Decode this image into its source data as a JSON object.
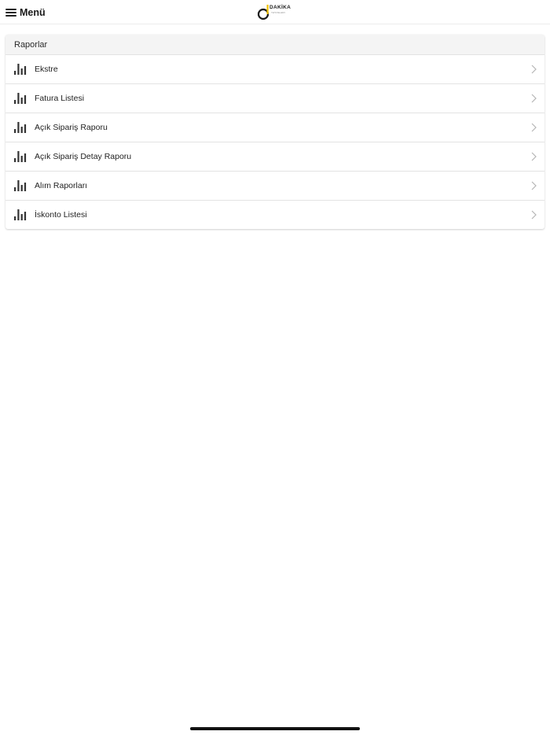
{
  "header": {
    "menu_label": "Menü",
    "logo_text": "DAKİKA",
    "logo_subtext": "YAYINLARI"
  },
  "card": {
    "title": "Raporlar",
    "items": [
      {
        "label": "Ekstre",
        "icon": "bar-chart-icon"
      },
      {
        "label": "Fatura Listesi",
        "icon": "bar-chart-icon"
      },
      {
        "label": "Açık Sipariş Raporu",
        "icon": "bar-chart-icon"
      },
      {
        "label": "Açık Sipariş Detay Raporu",
        "icon": "bar-chart-icon"
      },
      {
        "label": "Alım Raporları",
        "icon": "bar-chart-icon"
      },
      {
        "label": "İskonto Listesi",
        "icon": "bar-chart-icon"
      }
    ]
  },
  "colors": {
    "logo_accent": "#f2c200",
    "text_primary": "#1f1f1f",
    "header_bg": "#f4f4f4",
    "divider": "#e3e3e3"
  }
}
